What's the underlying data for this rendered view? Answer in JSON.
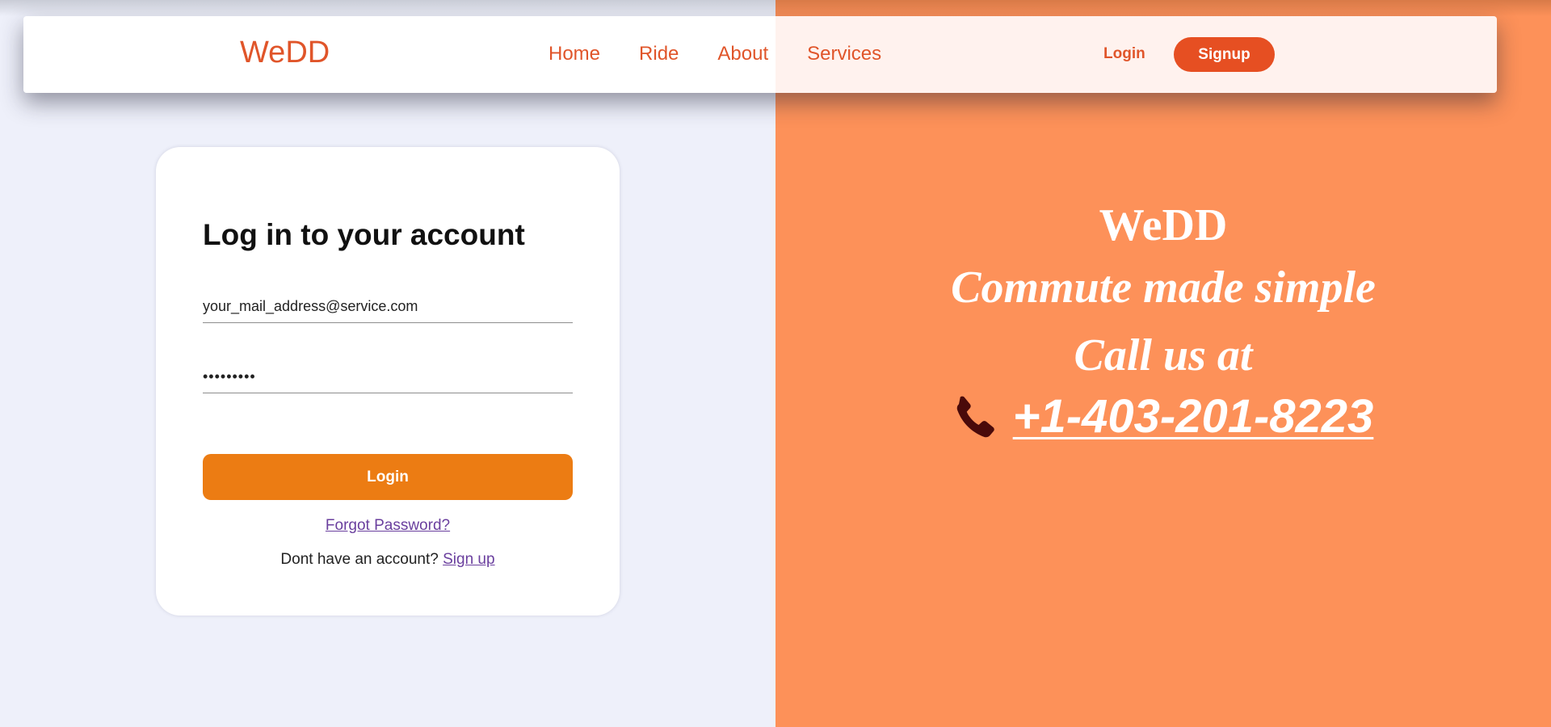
{
  "navbar": {
    "brand": "WeDD",
    "links": [
      {
        "label": "Home"
      },
      {
        "label": "Ride"
      },
      {
        "label": "About"
      },
      {
        "label": "Services"
      }
    ],
    "login_label": "Login",
    "signup_label": "Signup"
  },
  "login_card": {
    "title": "Log in to your account",
    "email_value": "your_mail_address@service.com",
    "password_value": "•••••••••",
    "login_button": "Login",
    "forgot_password": "Forgot Password?",
    "no_account_text": "Dont have an account?",
    "signup_link": "Sign up"
  },
  "hero": {
    "brand": "WeDD",
    "tagline": "Commute made simple",
    "call_text": "Call us at",
    "phone_icon": "phone-icon",
    "phone_number": "+1-403-201-8223"
  },
  "colors": {
    "accent": "#e0552a",
    "signup_button": "#e64f22",
    "login_button": "#ec7c13",
    "right_panel": "#fd9159",
    "left_panel": "#eef0fa",
    "link": "#6a3f9e",
    "phone_icon": "#4a0a0a"
  }
}
